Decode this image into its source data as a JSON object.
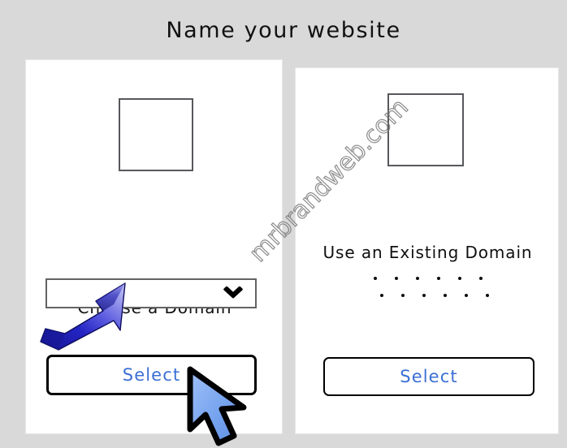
{
  "page": {
    "title": "Name your website",
    "background_color": "#d9d9d9",
    "watermark": "mrbrandweb.com"
  },
  "cards": [
    {
      "id": "choose-domain",
      "image_placeholder": "image-placeholder",
      "label": "Choose a Domain",
      "control": {
        "type": "select",
        "value": "",
        "placeholder": "",
        "icon": "chevron-down-icon"
      },
      "button": {
        "label": "Select",
        "text_color": "#3b6fd4",
        "border_color": "#000000"
      }
    },
    {
      "id": "existing-domain",
      "image_placeholder": "image-placeholder",
      "label": "Use an Existing Domain",
      "control": {
        "type": "dots",
        "rows": [
          [
            "dot",
            "dot",
            "dot",
            "dot",
            "dot",
            "dot"
          ],
          [
            "dot",
            "dot",
            "dot",
            "dot",
            "dot",
            "dot"
          ]
        ]
      },
      "button": {
        "label": "Select",
        "text_color": "#3b6fd4",
        "border_color": "#000000"
      }
    }
  ],
  "cursors": [
    {
      "name": "dark-blue-arrow-cursor",
      "points_to": "domain-select-dropdown",
      "color": "#1a1ab4"
    },
    {
      "name": "light-blue-arrow-cursor",
      "points_to": "select-button-left",
      "color": "#7aa7f0"
    }
  ]
}
